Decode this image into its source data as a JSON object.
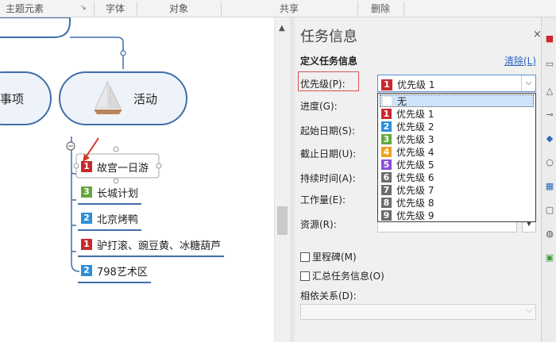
{
  "ribbon": {
    "groups": [
      "主题元素",
      "字体",
      "对象",
      "共享",
      "删除"
    ]
  },
  "mindmap": {
    "topics": {
      "left_partial": "事项",
      "activity": "活动"
    },
    "subtopics": [
      {
        "priority": "1",
        "color": "#c9282d",
        "label": "故宫一日游"
      },
      {
        "priority": "3",
        "color": "#62a83a",
        "label": "长城计划"
      },
      {
        "priority": "2",
        "color": "#2d8fd9",
        "label": "北京烤鸭"
      },
      {
        "priority": "1",
        "color": "#c9282d",
        "label": "驴打滚、豌豆黄、冰糖葫芦"
      },
      {
        "priority": "2",
        "color": "#2d8fd9",
        "label": "798艺术区"
      }
    ],
    "collapse_symbol": "−"
  },
  "panel": {
    "title": "任务信息",
    "close": "×",
    "section_title": "定义任务信息",
    "clear_link": "清除(L)",
    "labels": {
      "priority": "优先级(P):",
      "progress": "进度(G):",
      "start": "起始日期(S):",
      "due": "截止日期(U):",
      "duration": "持续时间(A):",
      "work": "工作量(E):",
      "resource": "资源(R):",
      "milestone": "里程碑(M)",
      "summary": "汇总任务信息(O)",
      "dependency": "相依关系(D):"
    },
    "priority_selected": {
      "num": "1",
      "color": "#c9282d",
      "label": "优先级 1"
    },
    "priority_options": [
      {
        "num": "",
        "color": "",
        "label": "无"
      },
      {
        "num": "1",
        "color": "#c9282d",
        "label": "优先级 1"
      },
      {
        "num": "2",
        "color": "#2d8fd9",
        "label": "优先级 2"
      },
      {
        "num": "3",
        "color": "#62a83a",
        "label": "优先级 3"
      },
      {
        "num": "4",
        "color": "#f0a21c",
        "label": "优先级 4"
      },
      {
        "num": "5",
        "color": "#8a4fd6",
        "label": "优先级 5"
      },
      {
        "num": "6",
        "color": "#6b6b6b",
        "label": "优先级 6"
      },
      {
        "num": "7",
        "color": "#6b6b6b",
        "label": "优先级 7"
      },
      {
        "num": "8",
        "color": "#6b6b6b",
        "label": "优先级 8"
      },
      {
        "num": "9",
        "color": "#6b6b6b",
        "label": "优先级 9"
      }
    ]
  }
}
